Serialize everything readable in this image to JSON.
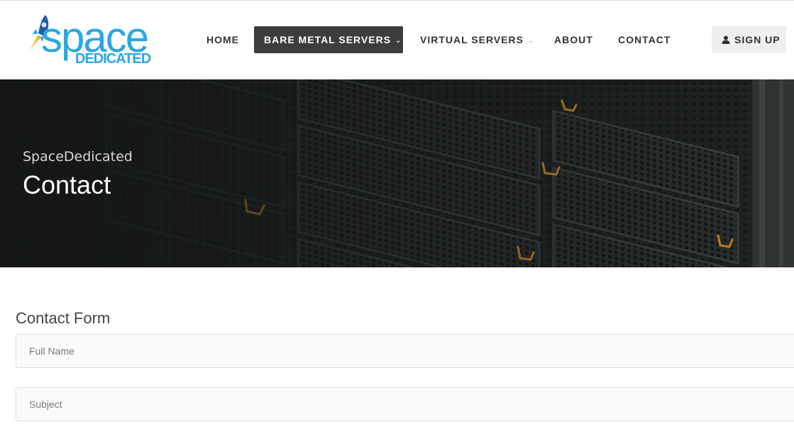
{
  "brand": {
    "logo_main": "space",
    "logo_sub": "DEDICATED",
    "accent_color": "#2aa7e6"
  },
  "nav": {
    "items": [
      {
        "label": "HOME",
        "has_dropdown": false,
        "active": false
      },
      {
        "label": "BARE METAL SERVERS",
        "has_dropdown": true,
        "active": true
      },
      {
        "label": "VIRTUAL SERVERS",
        "has_dropdown": true,
        "active": false
      },
      {
        "label": "ABOUT",
        "has_dropdown": false,
        "active": false
      },
      {
        "label": "CONTACT",
        "has_dropdown": false,
        "active": false
      }
    ],
    "signup_label": "SIGN UP",
    "signup_icon": "user-icon",
    "dropdown_icon": "chevron-down-icon"
  },
  "hero": {
    "site_name": "SpaceDedicated",
    "page_title": "Contact"
  },
  "form": {
    "title": "Contact Form",
    "full_name_placeholder": "Full Name",
    "full_name_value": "",
    "subject_placeholder": "Subject",
    "subject_value": ""
  }
}
